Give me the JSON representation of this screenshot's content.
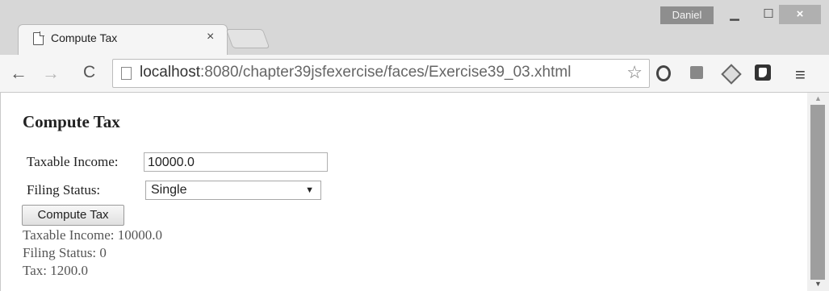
{
  "window": {
    "user": "Daniel",
    "minimize_glyph": "▁",
    "maximize_glyph": "☐",
    "close_glyph": "×"
  },
  "tab": {
    "title": "Compute Tax",
    "close_glyph": "×"
  },
  "toolbar": {
    "back_glyph": "←",
    "forward_glyph": "→",
    "reload_glyph": "C",
    "url_host": "localhost",
    "url_path": ":8080/chapter39jsfexercise/faces/Exercise39_03.xhtml",
    "bookmark_glyph": "☆",
    "menu_glyph": "≡",
    "extensions": [
      "opera-icon",
      "stack-icon",
      "cube-icon",
      "shield-icon"
    ]
  },
  "page": {
    "title": "Compute Tax",
    "income_label": "Taxable Income:",
    "income_value": "10000.0",
    "status_label": "Filing Status:",
    "status_selected": "Single",
    "compute_button": "Compute Tax",
    "result_income": "Taxable Income: 10000.0",
    "result_status": "Filing Status: 0",
    "result_tax": "Tax: 1200.0"
  },
  "scrollbar": {
    "up_glyph": "▲",
    "down_glyph": "▼"
  }
}
